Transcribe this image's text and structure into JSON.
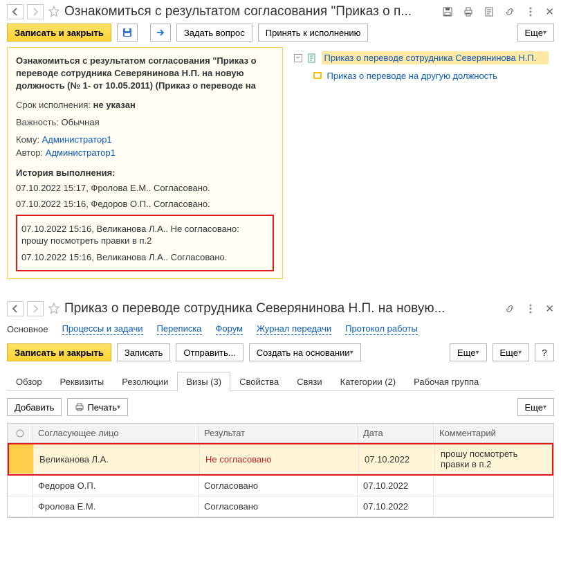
{
  "upper": {
    "title": "Ознакомиться с результатом согласования \"Приказ о п...",
    "toolbar": {
      "save_close": "Записать и закрыть",
      "ask": "Задать вопрос",
      "accept": "Принять к исполнению",
      "more": "Еще"
    },
    "card": {
      "title": "Ознакомиться с результатом согласования \"Приказ о переводе сотрудника Северянинова Н.П. на новую должность (№ 1- от 10.05.2011) (Приказ о переводе на",
      "deadline_label": "Срок исполнения:",
      "deadline_value": "не указан",
      "importance_label": "Важность:",
      "importance_value": "Обычная",
      "to_label": "Кому:",
      "to_value": "Администратор1",
      "author_label": "Автор:",
      "author_value": "Администратор1",
      "history_label": "История выполнения:",
      "history": [
        "07.10.2022 15:17, Фролова Е.М.. Согласовано.",
        "07.10.2022 15:16, Федоров О.П.. Согласовано."
      ],
      "history_boxed": [
        "07.10.2022 15:16, Великанова Л.А.. Не согласовано: прошу посмотреть правки в п.2",
        "07.10.2022 15:16, Великанова Л.А.. Согласовано."
      ]
    },
    "attachments": {
      "main": "Приказ о переводе сотрудника Северянинова Н.П.",
      "sub": "Приказ о переводе на другую должность"
    }
  },
  "lower": {
    "title": "Приказ о переводе сотрудника Северянинова Н.П. на новую...",
    "navtabs": {
      "main": "Основное",
      "proc": "Процессы и задачи",
      "corr": "Переписка",
      "forum": "Форум",
      "journal": "Журнал передачи",
      "proto": "Протокол работы"
    },
    "toolbar": {
      "save_close": "Записать и закрыть",
      "save": "Записать",
      "send": "Отправить...",
      "create_based": "Создать на основании",
      "more": "Еще",
      "help": "?"
    },
    "tabs": {
      "overview": "Обзор",
      "req": "Реквизиты",
      "res": "Резолюции",
      "visas": "Визы (3)",
      "props": "Свойства",
      "links": "Связи",
      "cats": "Категории (2)",
      "group": "Рабочая группа"
    },
    "subtoolbar": {
      "add": "Добавить",
      "print": "Печать",
      "more": "Еще"
    },
    "grid": {
      "headers": {
        "person": "Согласующее лицо",
        "result": "Результат",
        "date": "Дата",
        "comment": "Комментарий"
      },
      "rows": [
        {
          "person": "Великанова Л.А.",
          "result": "Не согласовано",
          "date": "07.10.2022",
          "comment": "прошу посмотреть правки в п.2",
          "bad": true,
          "selected": true
        },
        {
          "person": "Федоров О.П.",
          "result": "Согласовано",
          "date": "07.10.2022",
          "comment": ""
        },
        {
          "person": "Фролова Е.М.",
          "result": "Согласовано",
          "date": "07.10.2022",
          "comment": ""
        }
      ]
    }
  }
}
